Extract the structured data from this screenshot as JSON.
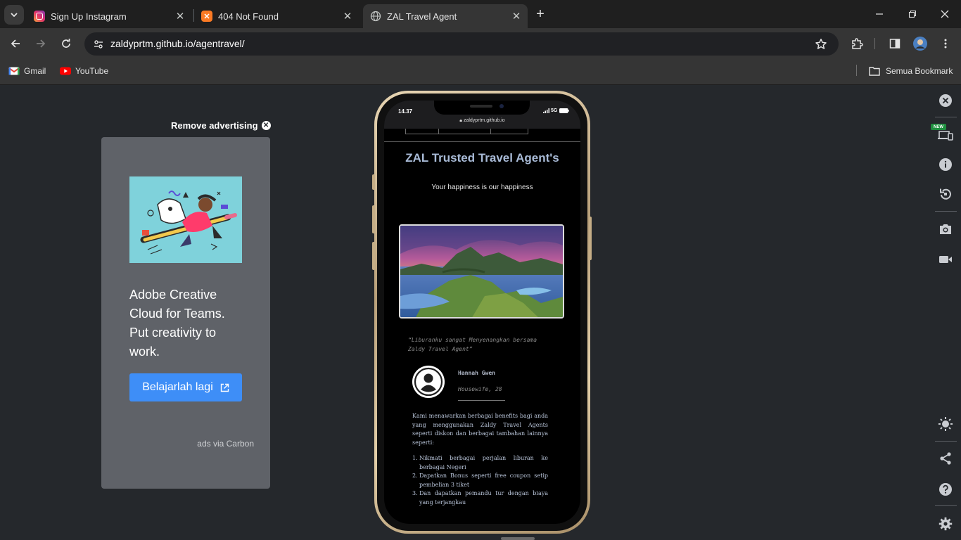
{
  "browser": {
    "tabs": [
      {
        "title": "Sign Up Instagram",
        "icon": "instagram-icon"
      },
      {
        "title": "404 Not Found",
        "icon": "xampp-icon"
      },
      {
        "title": "ZAL Travel Agent",
        "icon": "globe-icon",
        "active": true
      }
    ],
    "url": "zaldyprtm.github.io/agentravel/",
    "bookmarks": [
      {
        "label": "Gmail",
        "icon": "gmail-icon"
      },
      {
        "label": "YouTube",
        "icon": "youtube-icon"
      }
    ],
    "all_bookmarks_label": "Semua Bookmark"
  },
  "ad": {
    "remove_label": "Remove advertising",
    "headline": "Adobe Creative Cloud for Teams. Put creativity to work.",
    "button_label": "Belajarlah lagi",
    "via_label": "ads via Carbon"
  },
  "phone": {
    "time": "14.37",
    "network": "5G",
    "url": "zaldyprtm.github.io",
    "site": {
      "title": "ZAL Trusted Travel Agent's",
      "subtitle": "Your happiness is our happiness",
      "quote": "“Liburanku sangat Menyenangkan bersama Zaldy Travel Agent”",
      "testimonial_name": "Hannah Gwen",
      "testimonial_role": "Housewife, 28",
      "benefits_intro": "Kami menawarkan berbagai benefits bagi anda yang menggunakan Zaldy Travel Agents seperti diskon dan berbagai tambahan lainnya seperti:",
      "benefits": [
        "Nikmati berbagai perjalan liburan ke berbagai Negeri",
        "Dapatkan Bonus seperti free coupon setip pembelian 3 tiket",
        "Dan dapatkan pemandu tur dengan biaya yang terjangkau"
      ]
    }
  },
  "side_panel": {
    "new_badge": "NEW"
  },
  "colors": {
    "ad_button": "#3e8ef7",
    "site_title": "#a8bad6",
    "page_bg": "#25282c"
  }
}
